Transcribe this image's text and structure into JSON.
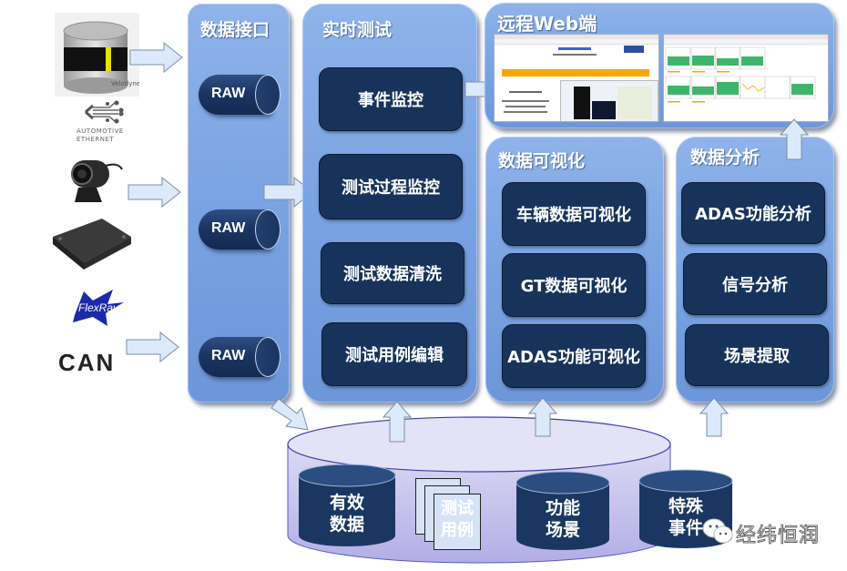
{
  "sources": {
    "lidar_brand": "Velodyne",
    "ethernet_label_line1": "Automotive",
    "ethernet_label_line2": "Ethernet",
    "flexray_label": "FlexRay",
    "can_label": "CAN"
  },
  "data_interface": {
    "title": "数据接口",
    "raw_items": [
      "RAW",
      "RAW",
      "RAW"
    ]
  },
  "realtime_test": {
    "title": "实时测试",
    "items": [
      "事件监控",
      "测试过程监控",
      "测试数据清洗",
      "测试用例编辑"
    ]
  },
  "remote_web": {
    "title": "远程Web端"
  },
  "data_visualization": {
    "title": "数据可视化",
    "items": [
      "车辆数据可视化",
      "GT数据可视化",
      "ADAS功能可视化"
    ]
  },
  "data_analysis": {
    "title": "数据分析",
    "items": [
      "ADAS功能分析",
      "信号分析",
      "场景提取"
    ]
  },
  "database": {
    "items": [
      {
        "line1": "有效",
        "line2": "数据"
      },
      {
        "line1": "测试",
        "line2": "用例"
      },
      {
        "line1": "功能",
        "line2": "场景"
      },
      {
        "line1": "特殊",
        "line2": "事件"
      }
    ]
  },
  "watermark": {
    "text": "经纬恒润"
  },
  "colors": {
    "panel_blue": "#7aa3e3",
    "node_navy": "#18335b",
    "db_lavender": "#d8d6f2",
    "arrow_fill": "#dce9fa",
    "web_orange": "#f7a800",
    "chart_green": "#3fb56b"
  }
}
